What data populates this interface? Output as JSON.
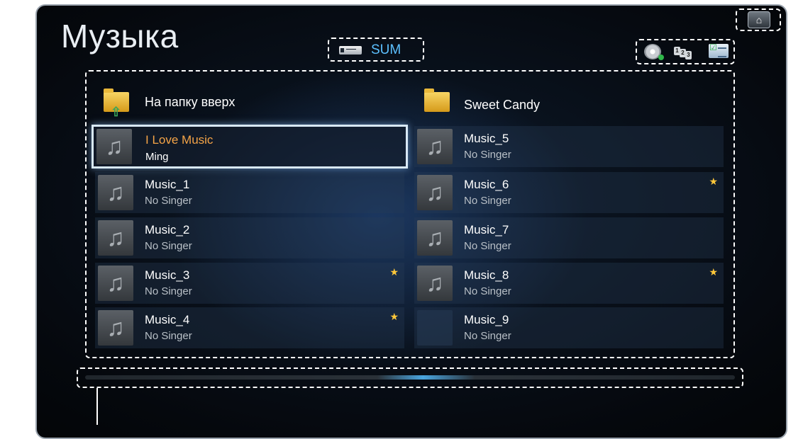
{
  "app": {
    "title": "Музыка"
  },
  "source": {
    "label": "SUM",
    "icon": "usb-drive-icon"
  },
  "home": {
    "icon": "home-icon"
  },
  "tools": [
    {
      "name": "disc-play-icon"
    },
    {
      "name": "sort-order-icon"
    },
    {
      "name": "select-list-icon"
    }
  ],
  "left_column": {
    "folder_up": {
      "label": "На папку вверх",
      "icon": "folder-up-icon"
    },
    "items": [
      {
        "title": "I Love Music",
        "artist": "Ming",
        "selected": true,
        "favorite": false
      },
      {
        "title": "Music_1",
        "artist": "No Singer",
        "selected": false,
        "favorite": false
      },
      {
        "title": "Music_2",
        "artist": "No Singer",
        "selected": false,
        "favorite": false
      },
      {
        "title": "Music_3",
        "artist": "No Singer",
        "selected": false,
        "favorite": true
      },
      {
        "title": "Music_4",
        "artist": "No Singer",
        "selected": false,
        "favorite": true
      }
    ]
  },
  "right_column": {
    "folder": {
      "label": "Sweet Candy",
      "icon": "folder-icon"
    },
    "items": [
      {
        "title": "Music_5",
        "artist": "No Singer",
        "favorite": false,
        "thumbnail": true
      },
      {
        "title": "Music_6",
        "artist": "No Singer",
        "favorite": true,
        "thumbnail": true
      },
      {
        "title": "Music_7",
        "artist": "No Singer",
        "favorite": false,
        "thumbnail": true
      },
      {
        "title": "Music_8",
        "artist": "No Singer",
        "favorite": true,
        "thumbnail": true
      },
      {
        "title": "Music_9",
        "artist": "No Singer",
        "favorite": false,
        "thumbnail": false
      }
    ]
  },
  "colors": {
    "selected_title": "#f5a447",
    "source_label": "#5cc0ff",
    "favorite_star": "#ffc83a"
  }
}
